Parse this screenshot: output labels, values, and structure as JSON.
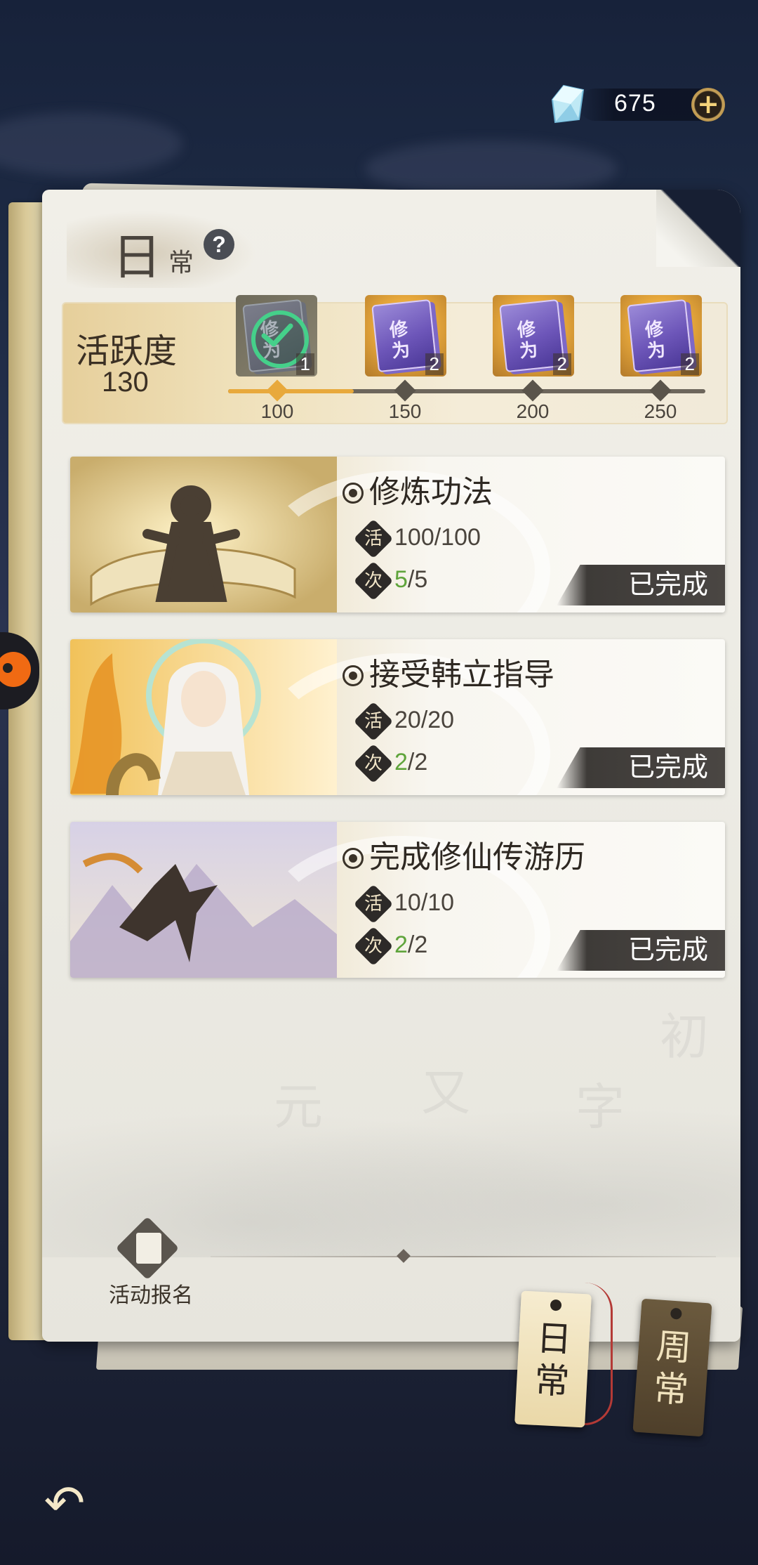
{
  "currency": {
    "amount": "675",
    "plus_label": "+"
  },
  "panel": {
    "title_big": "日",
    "title_small": "常",
    "help_label": "?"
  },
  "activity": {
    "label": "活跃度",
    "value": 130,
    "progress_max": 250,
    "milestones": [
      {
        "threshold": "100",
        "book_text": "修为",
        "count": "1",
        "claimed": true
      },
      {
        "threshold": "150",
        "book_text": "修为",
        "count": "2",
        "claimed": false
      },
      {
        "threshold": "200",
        "book_text": "修为",
        "count": "2",
        "claimed": false
      },
      {
        "threshold": "250",
        "book_text": "修为",
        "count": "2",
        "claimed": false
      }
    ]
  },
  "tasks": [
    {
      "name": "修炼功法",
      "activity_icon": "活",
      "activity": "100/100",
      "times_icon": "次",
      "times_done": "5",
      "times_total": "/5",
      "status": "已完成"
    },
    {
      "name": "接受韩立指导",
      "activity_icon": "活",
      "activity": "20/20",
      "times_icon": "次",
      "times_done": "2",
      "times_total": "/2",
      "status": "已完成"
    },
    {
      "name": "完成修仙传游历",
      "activity_icon": "活",
      "activity": "10/10",
      "times_icon": "次",
      "times_done": "2",
      "times_total": "/2",
      "status": "已完成"
    }
  ],
  "signup": {
    "label": "活动报名"
  },
  "tabs": {
    "daily_1": "日",
    "daily_2": "常",
    "weekly_1": "周",
    "weekly_2": "常"
  },
  "back_label": "↶",
  "colors": {
    "accent": "#e8a93c",
    "complete_green": "#5fa43b",
    "done_button": "#3e3b38"
  }
}
